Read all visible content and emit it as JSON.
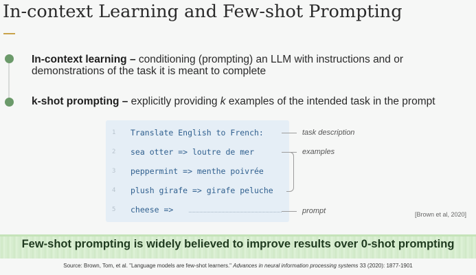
{
  "slide": {
    "title": "In-context Learning and Few-shot Prompting",
    "accent_color": "#c8a24a",
    "bullet_color": "#6b9a6a"
  },
  "bullets": [
    {
      "term": "In-context learning –",
      "text": " conditioning (prompting) an LLM with instructions and or demonstrations of the task it is meant to complete"
    },
    {
      "term": "k-shot prompting –",
      "text_before": " explicitly providing ",
      "k": "k",
      "text_after": " examples of the intended task in the prompt"
    }
  ],
  "code_example": {
    "lines": [
      {
        "num": "1",
        "text": "Translate English to French:"
      },
      {
        "num": "2",
        "text": "sea otter => loutre de mer"
      },
      {
        "num": "3",
        "text": "peppermint => menthe poivrée"
      },
      {
        "num": "4",
        "text": "plush girafe => girafe peluche"
      },
      {
        "num": "5",
        "text": "cheese =>"
      }
    ],
    "annotations": {
      "task_description": "task description",
      "examples": "examples",
      "prompt": "prompt"
    },
    "citation": "[Brown et al, 2020]"
  },
  "banner": {
    "text": "Few-shot prompting is widely believed to improve results over 0-shot prompting"
  },
  "source": {
    "prefix": "Source: Brown, Tom, et al. \"Language models are few-shot learners.\" ",
    "journal": "Advances in neural information processing systems",
    "suffix": " 33 (2020): 1877-1901"
  }
}
